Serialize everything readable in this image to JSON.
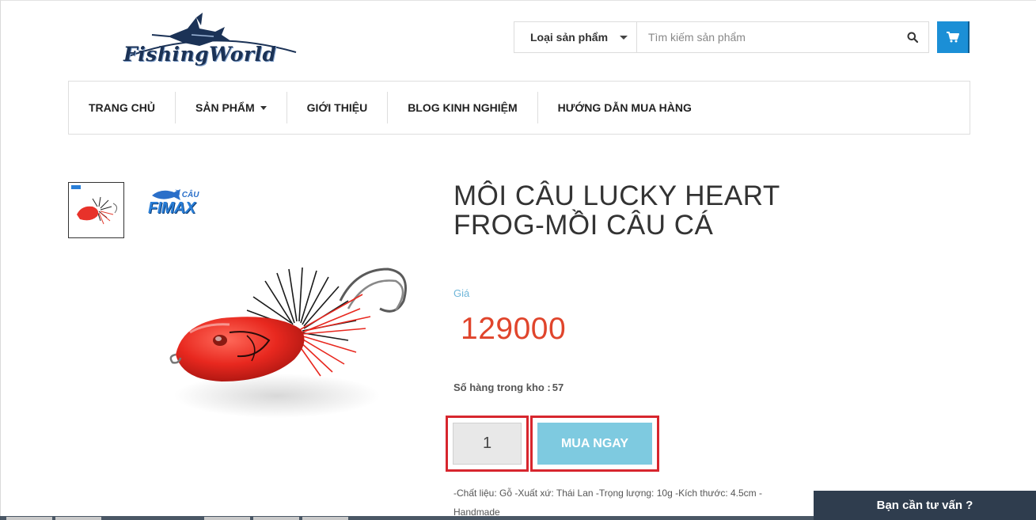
{
  "header": {
    "logo_text": "FishingWorld",
    "category_label": "Loại sản phẩm",
    "search_placeholder": "Tìm kiếm sản phẩm"
  },
  "nav": {
    "items": [
      {
        "label": "TRANG CHỦ"
      },
      {
        "label": "SẢN PHẨM",
        "has_dropdown": true
      },
      {
        "label": "GIỚI THIỆU"
      },
      {
        "label": "BLOG KINH NGHIỆM"
      },
      {
        "label": "HƯỚNG DẪN MUA HÀNG"
      }
    ]
  },
  "gallery": {
    "brand_top": "ĐỒ CÂU",
    "brand_name": "FIMAX"
  },
  "product": {
    "title": "MÔI CÂU LUCKY HEART FROG-MỒI CÂU CÁ",
    "price_label": "Giá",
    "price": "129000",
    "stock_label": "Số hàng trong kho :",
    "stock_value": "57",
    "quantity": "1",
    "buy_label": "MUA NGAY",
    "description": "-Chất liệu: Gỗ -Xuất xứ: Thái Lan -Trọng lượng: 10g -Kích thước: 4.5cm -Handmade"
  },
  "chat": {
    "label": "Bạn cần tư vấn ?"
  },
  "colors": {
    "accent_blue": "#1b8fd6",
    "price_red": "#e0452c",
    "buy_button": "#7ecae0",
    "highlight_border": "#d7262e",
    "chat_bg": "#2f3d4e"
  },
  "icons": {
    "search": "search-icon",
    "cart": "cart-icon",
    "caret": "caret-down-icon"
  }
}
